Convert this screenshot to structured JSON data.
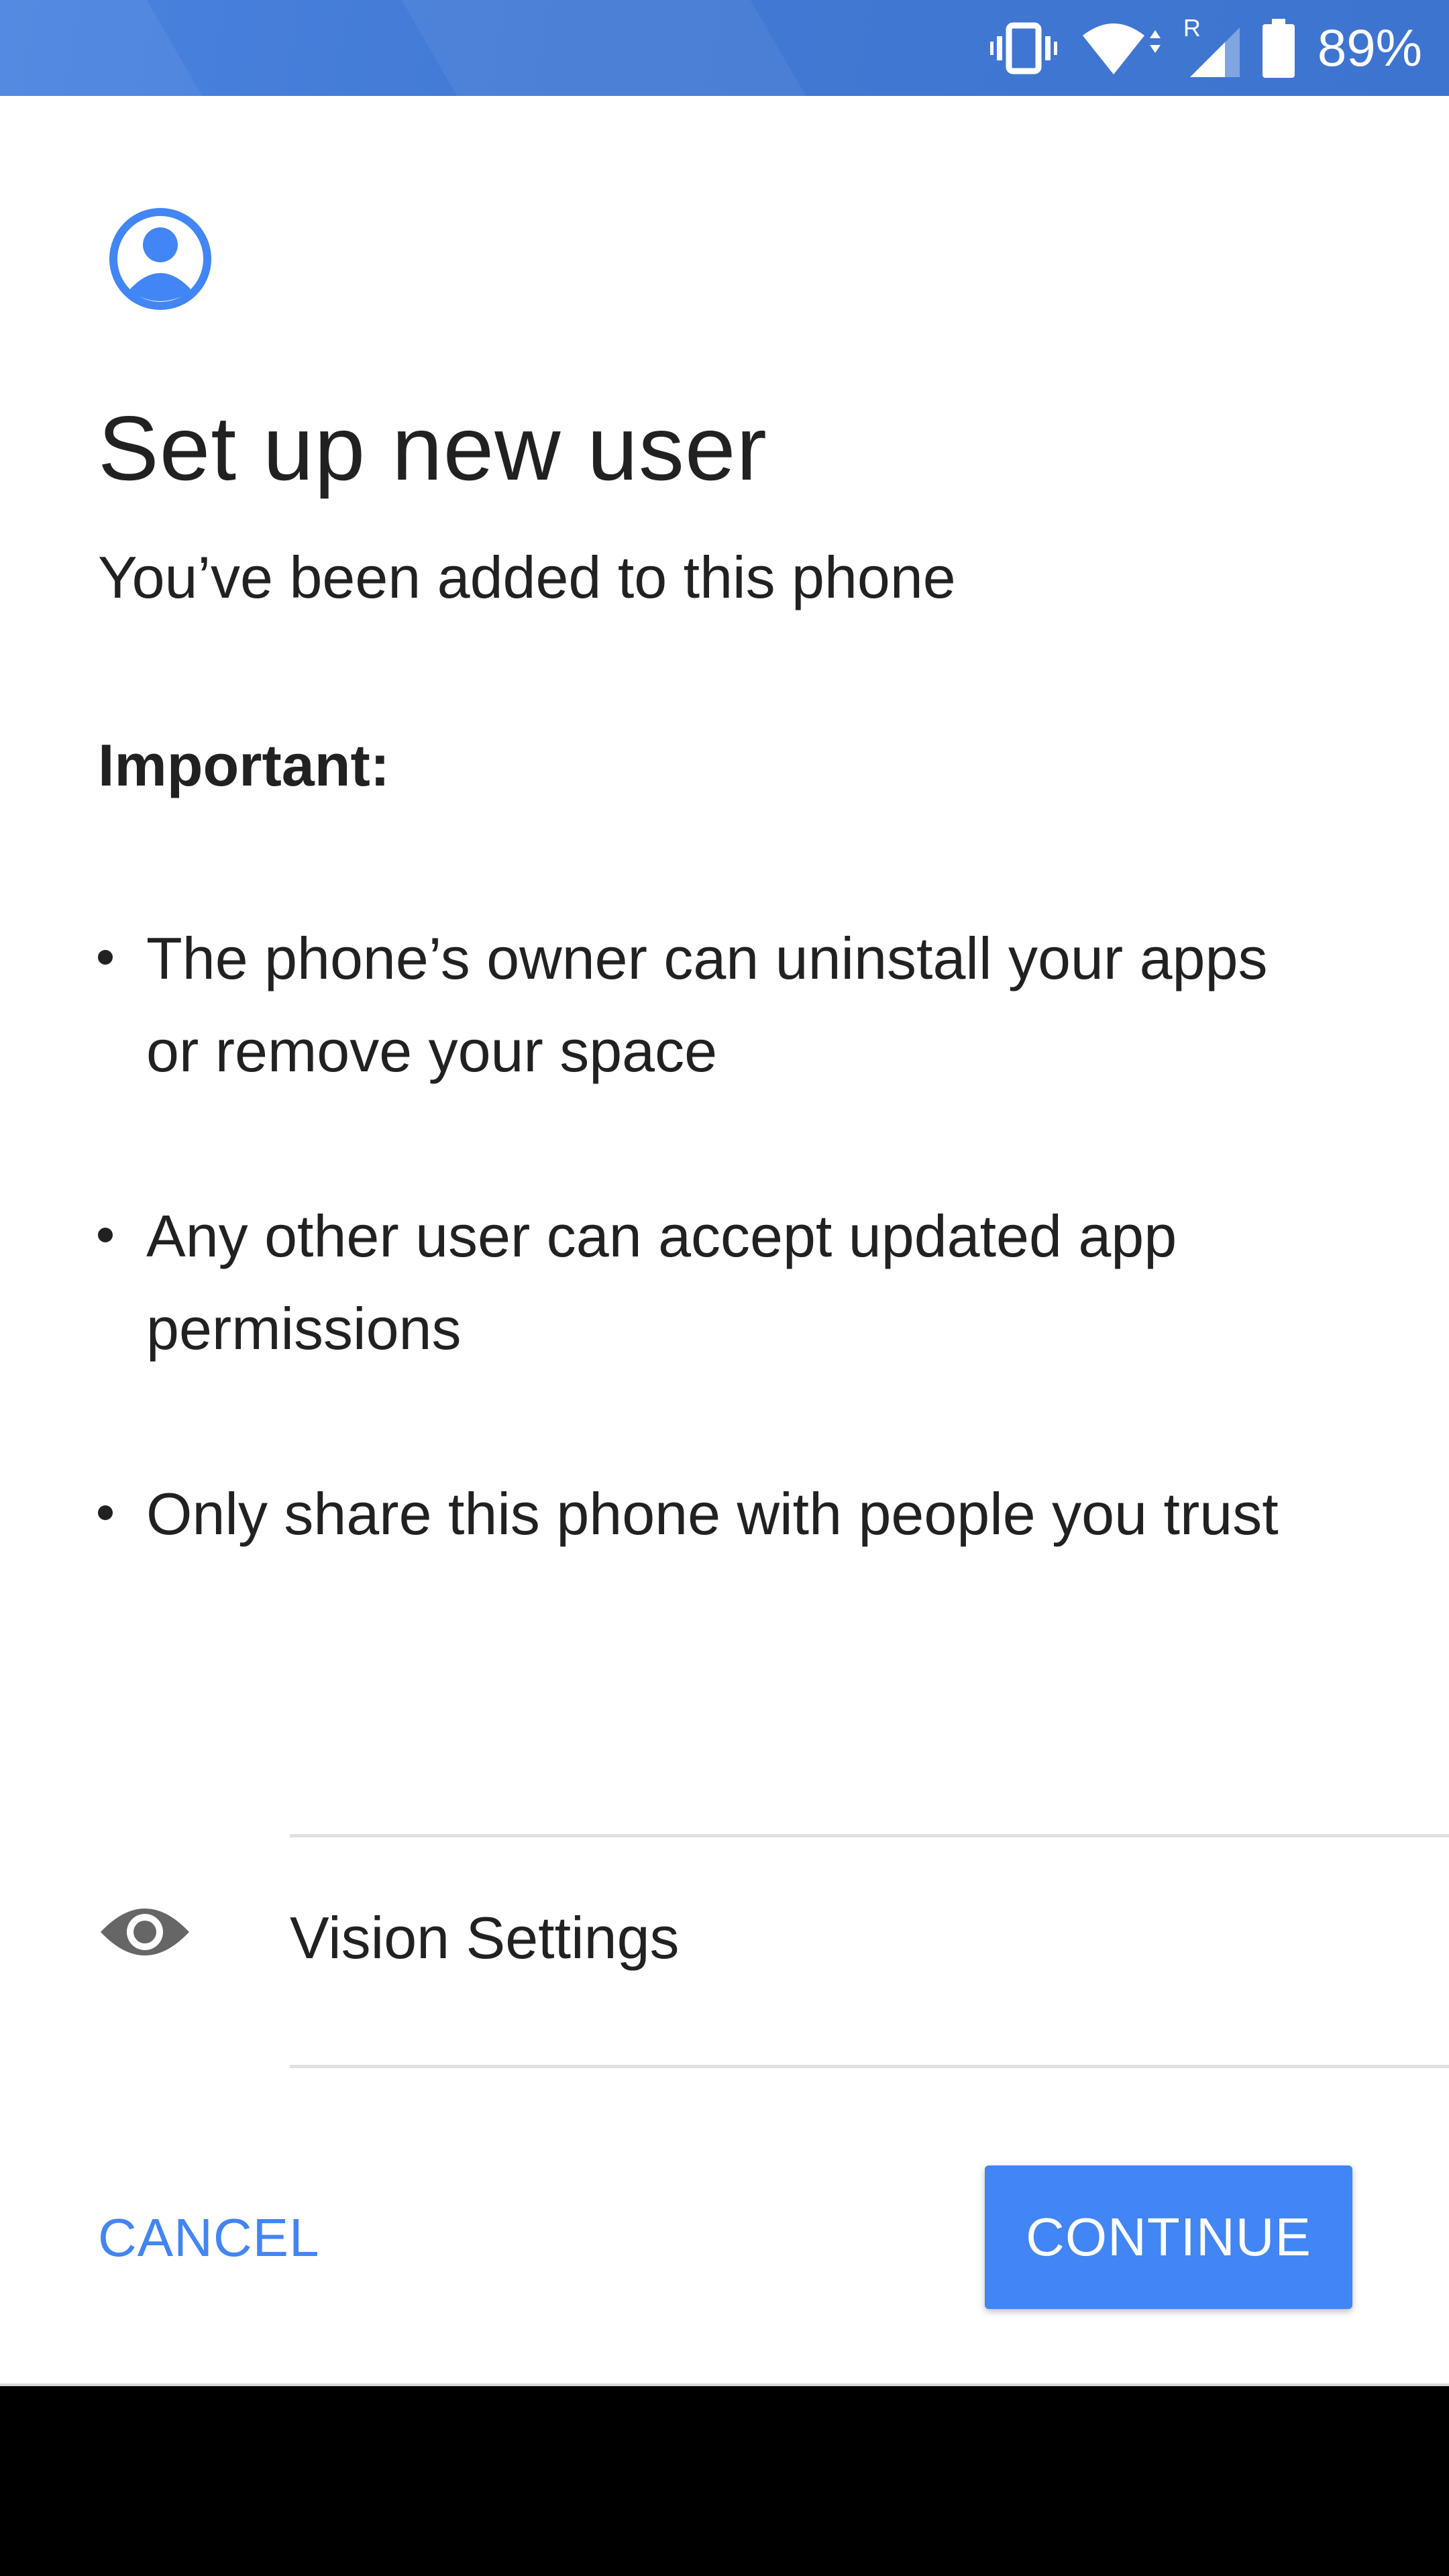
{
  "status_bar": {
    "battery_percent": "89%",
    "roaming_indicator": "R",
    "icons": [
      "vibrate-icon",
      "wifi-icon",
      "signal-icon",
      "battery-icon"
    ],
    "color": "#4179d4"
  },
  "header": {
    "icon": "account-circle-icon",
    "title": "Set up new user",
    "subtitle": "You’ve been added to this phone"
  },
  "notice": {
    "heading": "Important:",
    "items": [
      "The phone’s owner can uninstall your apps or remove your space",
      "Any other user can accept updated app permissions",
      "Only share this phone with people you trust"
    ]
  },
  "vision_settings": {
    "icon": "eye-icon",
    "label": "Vision Settings"
  },
  "actions": {
    "cancel_label": "CANCEL",
    "continue_label": "CONTINUE",
    "accent_color": "#4285f4"
  }
}
